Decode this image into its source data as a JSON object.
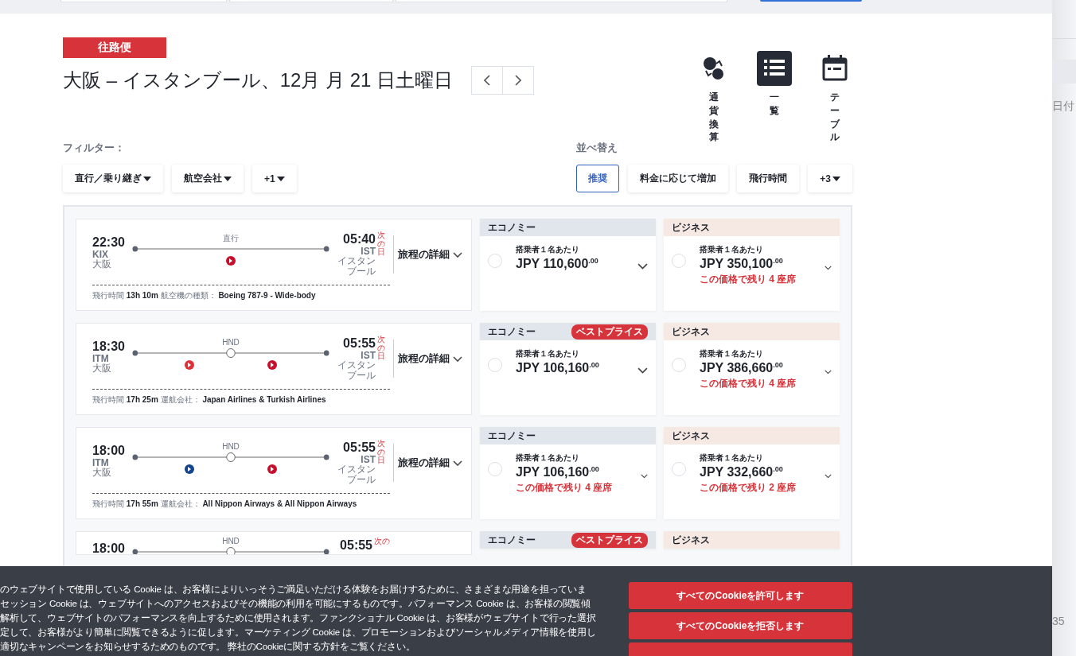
{
  "header": {
    "badge": "往路便",
    "title": "大阪 – イスタンブール、12月 月 21 日土曜日"
  },
  "views": [
    {
      "kind": "currency",
      "label": "通貨換算",
      "selected": false
    },
    {
      "kind": "list",
      "label": "一覧",
      "selected": true
    },
    {
      "kind": "calendar",
      "label": "テーブル",
      "selected": false
    }
  ],
  "filters": {
    "label": "フィルター：",
    "buttons": [
      {
        "label": "直行／乗り継ぎ",
        "dropdown": true
      },
      {
        "label": "航空会社",
        "dropdown": true
      },
      {
        "label": "+1",
        "dropdown": true
      }
    ]
  },
  "sort": {
    "label": "並べ替え",
    "buttons": [
      {
        "label": "推奨",
        "selected": true,
        "dropdown": false
      },
      {
        "label": "料金に応じて増加",
        "selected": false,
        "dropdown": false
      },
      {
        "label": "飛行時間",
        "selected": false,
        "dropdown": false
      },
      {
        "label": "+3",
        "selected": false,
        "dropdown": true
      }
    ]
  },
  "results": [
    {
      "flight": {
        "kind": "nonstop",
        "depart_time": "22:30",
        "depart_code": "KIX",
        "depart_city": "大阪",
        "route_label": "直行",
        "arrive_time": "05:40",
        "arrive_code": "IST",
        "arrive_city": "イスタンブール",
        "next_day": "次の日",
        "details": "旅程の詳細",
        "duration_label": "飛行時間",
        "duration": "13h 10m",
        "info_label": "航空機の種類：",
        "info": "Boeing 787-9 - Wide-body",
        "carriers": [
          {
            "color": "#c8102e"
          }
        ]
      },
      "fares": [
        {
          "kind": "economy",
          "cabin": "エコノミー",
          "per_person": "搭乗者１名あたり",
          "price": "JPY 110,600",
          "decimals": ".00",
          "selected": false
        },
        {
          "kind": "business",
          "cabin": "ビジネス",
          "per_person": "搭乗者１名あたり",
          "price": "JPY 350,100",
          "decimals": ".00",
          "seats_left": "この価格で残り 4 座席",
          "selected": false
        }
      ]
    },
    {
      "flight": {
        "kind": "one-stop",
        "depart_time": "18:30",
        "depart_code": "ITM",
        "depart_city": "大阪",
        "route_label": "HND",
        "arrive_time": "05:55",
        "arrive_code": "IST",
        "arrive_city": "イスタンブール",
        "next_day": "次の日",
        "details": "旅程の詳細",
        "duration_label": "飛行時間",
        "duration": "17h 25m",
        "info_label": "運航会社：",
        "info": "Japan Airlines & Turkish Airlines",
        "carriers": [
          {
            "color": "#e0313b"
          },
          {
            "color": "#c8102e"
          }
        ]
      },
      "fares": [
        {
          "kind": "economy",
          "cabin": "エコノミー",
          "badge": "ベストプライス",
          "per_person": "搭乗者１名あたり",
          "price": "JPY 106,160",
          "decimals": ".00",
          "selected": false
        },
        {
          "kind": "business",
          "cabin": "ビジネス",
          "per_person": "搭乗者１名あたり",
          "price": "JPY 386,660",
          "decimals": ".00",
          "seats_left": "この価格で残り 4 座席",
          "selected": false
        }
      ]
    },
    {
      "flight": {
        "kind": "one-stop",
        "depart_time": "18:00",
        "depart_code": "ITM",
        "depart_city": "大阪",
        "route_label": "HND",
        "arrive_time": "05:55",
        "arrive_code": "IST",
        "arrive_city": "イスタンブール",
        "next_day": "次の日",
        "details": "旅程の詳細",
        "duration_label": "飛行時間",
        "duration": "17h 55m",
        "info_label": "運航会社：",
        "info": "All Nippon Airways & All Nippon Airways",
        "carriers": [
          {
            "color": "#13448f"
          },
          {
            "color": "#c8102e"
          }
        ]
      },
      "fares": [
        {
          "kind": "economy",
          "cabin": "エコノミー",
          "per_person": "搭乗者１名あたり",
          "price": "JPY 106,160",
          "decimals": ".00",
          "seats_left": "この価格で残り 4 座席",
          "selected": false
        },
        {
          "kind": "business",
          "cabin": "ビジネス",
          "per_person": "搭乗者１名あたり",
          "price": "JPY 332,660",
          "decimals": ".00",
          "seats_left": "この価格で残り 2 座席",
          "selected": false
        }
      ]
    },
    {
      "flight": {
        "kind": "one-stop",
        "depart_time": "18:00",
        "route_label": "HND",
        "arrive_time": "05:55",
        "next_day": "次の"
      },
      "fares": [
        {
          "kind": "economy",
          "cabin": "エコノミー",
          "badge": "ベストプライス"
        },
        {
          "kind": "business",
          "cabin": "ビジネス"
        }
      ]
    }
  ],
  "side": {
    "column_1": "日付",
    "column_2": "35"
  },
  "cookie_banner": {
    "lines": [
      "のウェブサイトで使用している Cookie は、お客様によりいっそうご満足いただける体験をお届けするために、さまざまな用途を担っていま",
      "セッション Cookie は、ウェブサイトへのアクセスおよびその機能の利用を可能にするものです。パフォーマンス Cookie は、お客様の閲覧傾",
      "解析して、ウェブサイトのパフォーマンスを向上するために使用されます。ファンクショナル Cookie は、お客様がウェブサイトで行った選択",
      "定して、お客様がより簡単に閲覧できるように促します。マーケティング Cookie は、プロモーションおよびソーシャルメディア情報を使用し",
      "適切なキャンペーンをお知らせするためのものです。 弊社のCookieに関する方針をご覧ください。"
    ],
    "buttons": [
      "すべてのCookieを許可します",
      "すべてのCookieを拒否します"
    ]
  }
}
